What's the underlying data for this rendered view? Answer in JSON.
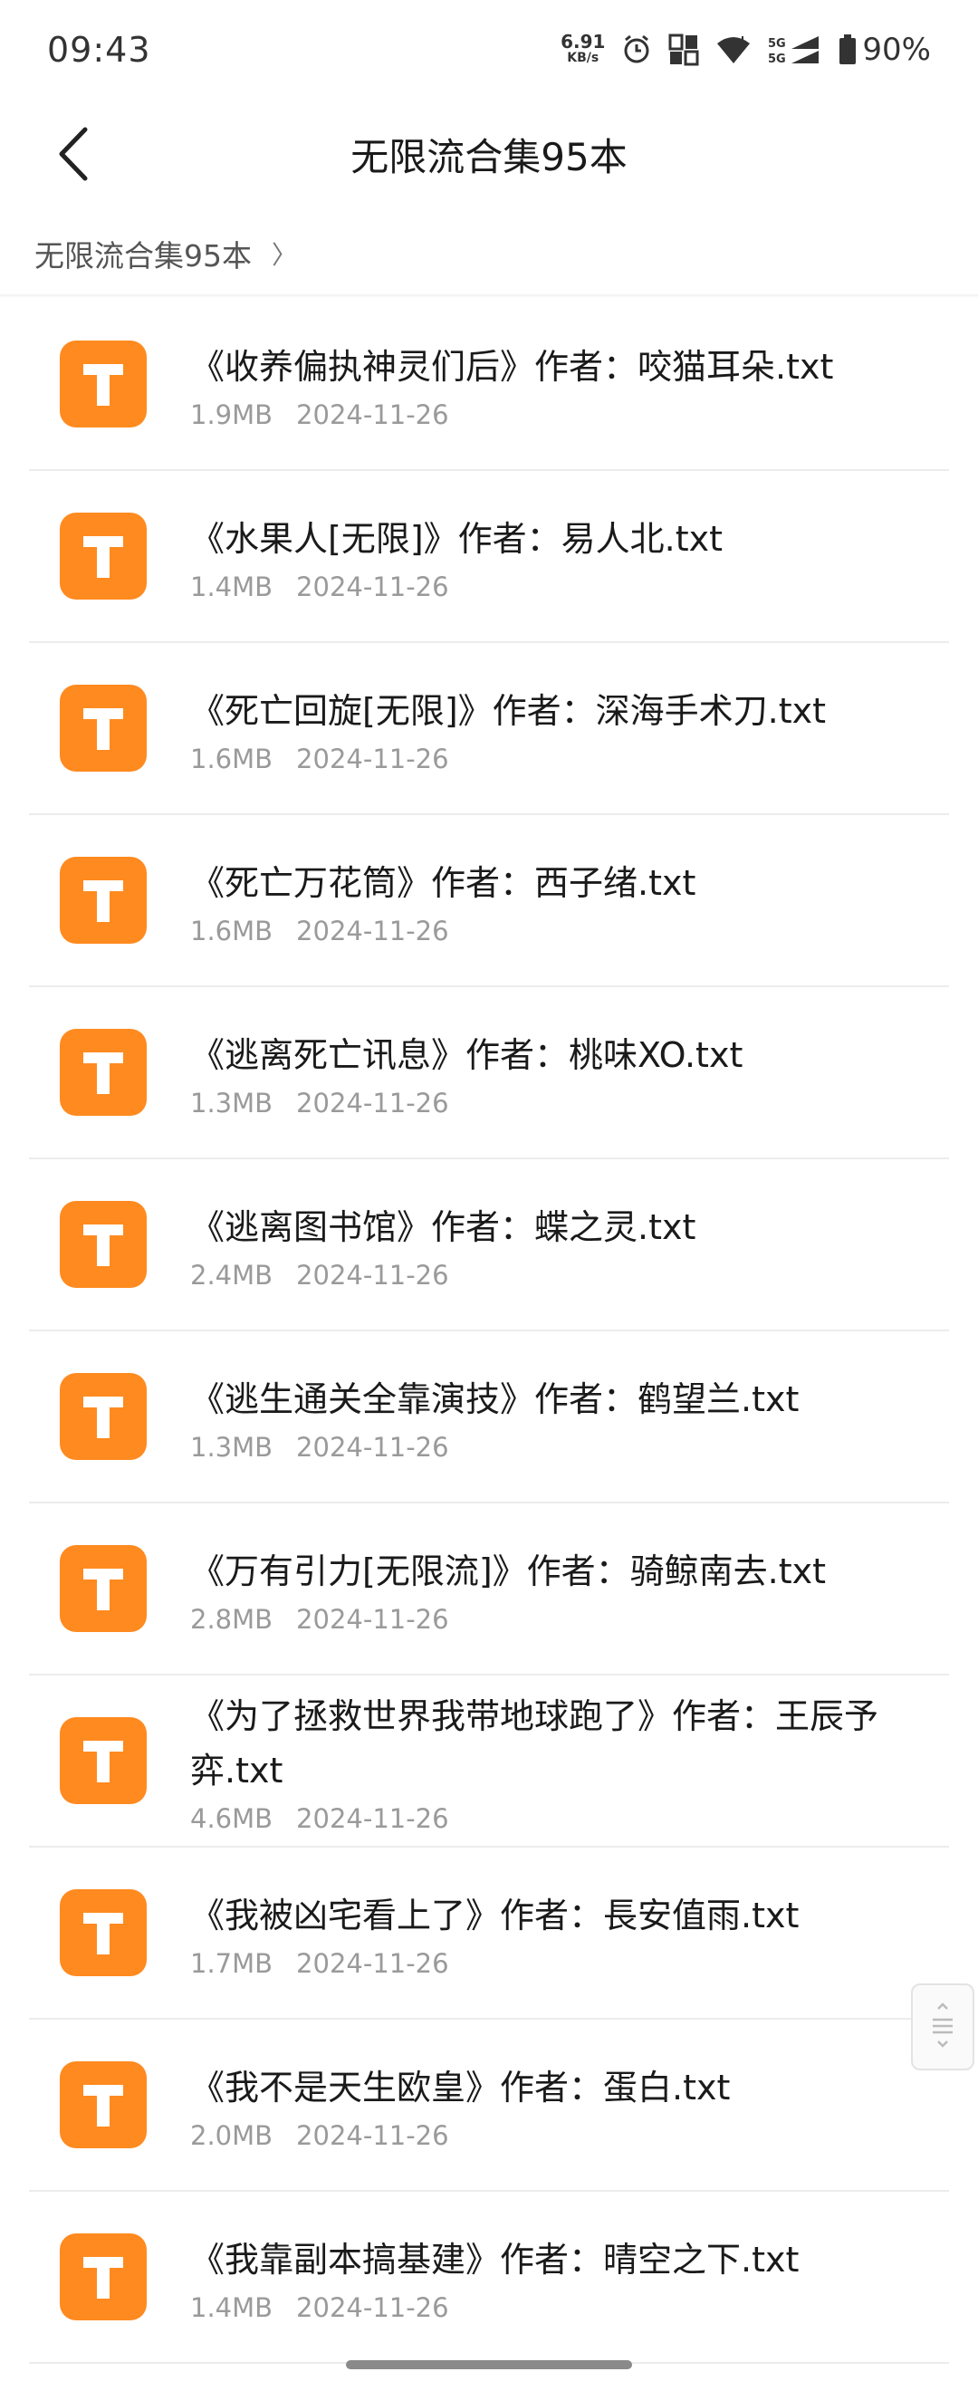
{
  "status_bar": {
    "time": "09:43",
    "net_speed_value": "6.91",
    "net_speed_unit": "KB/s",
    "signal_label": "5G",
    "battery": "90%"
  },
  "header": {
    "title": "无限流合集95本"
  },
  "breadcrumb": {
    "label": "无限流合集95本",
    "chevron": "〉"
  },
  "files": [
    {
      "name": "《收养偏执神灵们后》作者：咬猫耳朵.txt",
      "size": "1.9MB",
      "date": "2024-11-26"
    },
    {
      "name": "《水果人[无限]》作者：易人北.txt",
      "size": "1.4MB",
      "date": "2024-11-26"
    },
    {
      "name": "《死亡回旋[无限]》作者：深海手术刀.txt",
      "size": "1.6MB",
      "date": "2024-11-26"
    },
    {
      "name": "《死亡万花筒》作者：西子绪.txt",
      "size": "1.6MB",
      "date": "2024-11-26"
    },
    {
      "name": "《逃离死亡讯息》作者：桃味XO.txt",
      "size": "1.3MB",
      "date": "2024-11-26"
    },
    {
      "name": "《逃离图书馆》作者：蝶之灵.txt",
      "size": "2.4MB",
      "date": "2024-11-26"
    },
    {
      "name": "《逃生通关全靠演技》作者：鹤望兰.txt",
      "size": "1.3MB",
      "date": "2024-11-26"
    },
    {
      "name": "《万有引力[无限流]》作者：骑鲸南去.txt",
      "size": "2.8MB",
      "date": "2024-11-26"
    },
    {
      "name": "《为了拯救世界我带地球跑了》作者：王辰予弈.txt",
      "size": "4.6MB",
      "date": "2024-11-26"
    },
    {
      "name": "《我被凶宅看上了》作者：長安值雨.txt",
      "size": "1.7MB",
      "date": "2024-11-26"
    },
    {
      "name": "《我不是天生欧皇》作者：蛋白.txt",
      "size": "2.0MB",
      "date": "2024-11-26"
    },
    {
      "name": "《我靠副本搞基建》作者：晴空之下.txt",
      "size": "1.4MB",
      "date": "2024-11-26"
    }
  ],
  "icons": {
    "file": "txt-file-icon",
    "file_glyph": "T",
    "file_color": "#ff8a1f"
  }
}
